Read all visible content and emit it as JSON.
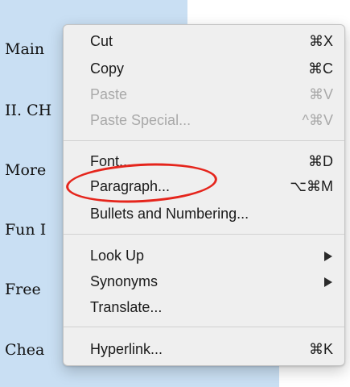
{
  "document": {
    "lines": [
      "Main",
      "II. CH",
      "More",
      "Fun I",
      "Free",
      "Chea"
    ]
  },
  "menu": {
    "cut": {
      "label": "Cut",
      "shortcut": "⌘X"
    },
    "copy": {
      "label": "Copy",
      "shortcut": "⌘C"
    },
    "paste": {
      "label": "Paste",
      "shortcut": "⌘V"
    },
    "paste_special": {
      "label": "Paste Special...",
      "shortcut": "^⌘V"
    },
    "font": {
      "label": "Font...",
      "shortcut": "⌘D"
    },
    "paragraph": {
      "label": "Paragraph...",
      "shortcut": "⌥⌘M"
    },
    "bullets": {
      "label": "Bullets and Numbering..."
    },
    "look_up": {
      "label": "Look Up",
      "icon": "submenu-arrow-icon"
    },
    "synonyms": {
      "label": "Synonyms",
      "icon": "submenu-arrow-icon"
    },
    "translate": {
      "label": "Translate..."
    },
    "hyperlink": {
      "label": "Hyperlink...",
      "shortcut": "⌘K"
    }
  },
  "colors": {
    "selection": "#c9dff3",
    "menu_background": "#efefef",
    "disabled_text": "#a9a9a9",
    "annotation": "#e5251c"
  }
}
